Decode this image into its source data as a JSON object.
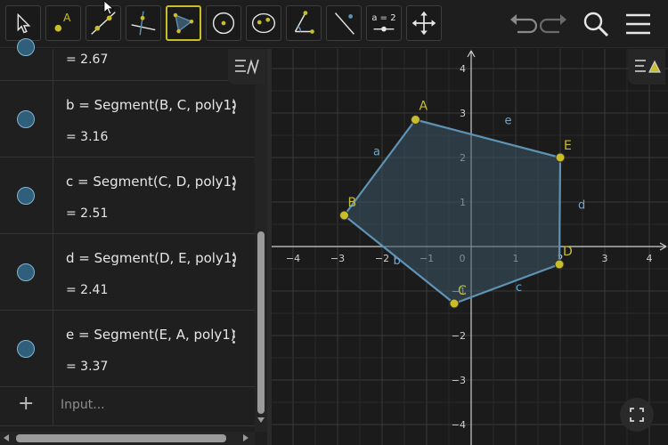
{
  "toolbar": {
    "tools": [
      {
        "name": "move-tool-icon"
      },
      {
        "name": "point-tool-icon"
      },
      {
        "name": "line-tool-icon"
      },
      {
        "name": "perpendicular-tool-icon"
      },
      {
        "name": "polygon-tool-icon",
        "active": true
      },
      {
        "name": "circle-tool-icon"
      },
      {
        "name": "conic-tool-icon"
      },
      {
        "name": "angle-tool-icon"
      },
      {
        "name": "reflect-tool-icon"
      },
      {
        "name": "slider-tool-icon",
        "label": "a = 2"
      },
      {
        "name": "move-graphics-tool-icon"
      }
    ],
    "accent_color": "#c9bd2a"
  },
  "algebra": {
    "partial_value": "= 2.67",
    "rows": [
      {
        "def": "b = Segment(B, C, poly1)",
        "value": "= 3.16"
      },
      {
        "def": "c = Segment(C, D, poly1)",
        "value": "= 2.51"
      },
      {
        "def": "d = Segment(D, E, poly1)",
        "value": "= 2.41"
      },
      {
        "def": "e = Segment(E, A, poly1)",
        "value": "= 3.37"
      }
    ],
    "input_placeholder": "Input..."
  },
  "graphics": {
    "x_ticks": [
      "−4",
      "−3",
      "−2",
      "−1",
      "0",
      "1",
      "2",
      "3",
      "4"
    ],
    "y_ticks": [
      "4",
      "3",
      "2",
      "1",
      "−1",
      "−2",
      "−3",
      "−4"
    ],
    "points": [
      {
        "label": "A",
        "x": -1.25,
        "y": 2.85
      },
      {
        "label": "E",
        "x": 2.0,
        "y": 2.0
      },
      {
        "label": "D",
        "x": 1.98,
        "y": -0.4
      },
      {
        "label": "C",
        "x": -0.38,
        "y": -1.28
      },
      {
        "label": "B",
        "x": -2.85,
        "y": 0.7
      }
    ],
    "segment_labels": [
      {
        "label": "a",
        "x": -2.2,
        "y": 2.05
      },
      {
        "label": "e",
        "x": 0.75,
        "y": 2.75
      },
      {
        "label": "d",
        "x": 2.4,
        "y": 0.85
      },
      {
        "label": "c",
        "x": 1.0,
        "y": -1.0
      },
      {
        "label": "b",
        "x": -1.75,
        "y": -0.4
      }
    ],
    "point_color": "#c9bd2a",
    "segment_color": "#5f93b5",
    "fill_color": "#3b5566"
  }
}
